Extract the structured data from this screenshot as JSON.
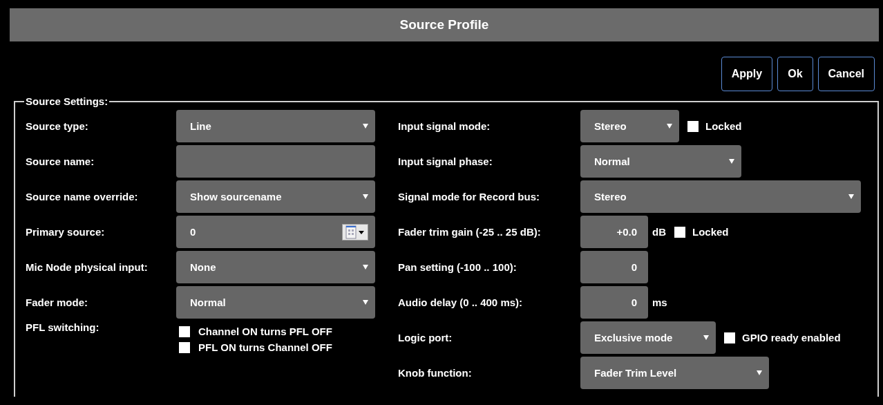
{
  "window": {
    "title": "Source Profile"
  },
  "buttons": [
    "Apply",
    "Ok",
    "Cancel"
  ],
  "source_settings": {
    "legend": "Source Settings:",
    "left": [
      {
        "label": "Source type:",
        "kind": "select",
        "value": "Line"
      },
      {
        "label": "Source name:",
        "kind": "text"
      },
      {
        "label": "Source name override:",
        "kind": "select",
        "value": "Show sourcename"
      },
      {
        "label": "Primary source:",
        "kind": "picker",
        "value": "0"
      },
      {
        "label": "Mic Node physical input:",
        "kind": "select",
        "value": "None"
      },
      {
        "label": "Fader mode:",
        "kind": "select",
        "value": "Normal"
      },
      {
        "label": "PFL switching:",
        "kind": "checks",
        "options": [
          {
            "label": "Channel ON turns PFL OFF",
            "checked": false
          },
          {
            "label": "PFL ON turns Channel OFF",
            "checked": false
          }
        ]
      }
    ],
    "right": [
      {
        "label": "Input signal mode:",
        "kind": "select",
        "value": "Stereo",
        "checkbox": {
          "label": "Locked",
          "checked": false
        }
      },
      {
        "label": "Input signal phase:",
        "kind": "select",
        "value": "Normal"
      },
      {
        "label": "Signal mode for Record bus:",
        "kind": "select",
        "value": "Stereo"
      },
      {
        "label": "Fader trim gain (-25 .. 25 dB):",
        "kind": "number",
        "value": "+0.0",
        "unit": "dB",
        "checkbox": {
          "label": "Locked",
          "checked": false
        }
      },
      {
        "label": "Pan setting (-100 .. 100):",
        "kind": "number",
        "value": "0"
      },
      {
        "label": "Audio delay (0 .. 400 ms):",
        "kind": "number",
        "value": "0",
        "unit": "ms"
      },
      {
        "label": "Logic port:",
        "kind": "select",
        "value": "Exclusive mode",
        "checkbox": {
          "label": "GPIO ready enabled",
          "checked": false
        }
      },
      {
        "label": "Knob function:",
        "kind": "select",
        "value": "Fader Trim Level"
      }
    ]
  }
}
